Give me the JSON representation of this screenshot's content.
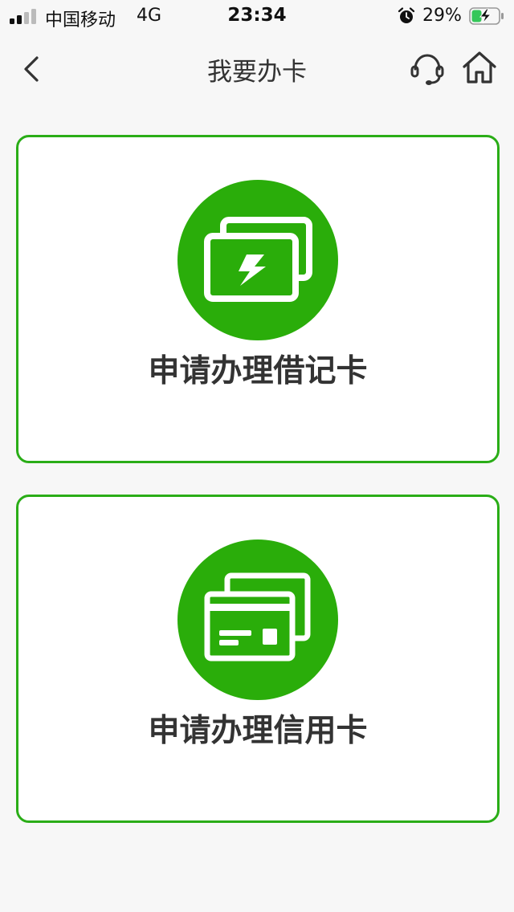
{
  "status_bar": {
    "carrier": "中国移动",
    "network": "4G",
    "time": "23:34",
    "battery_percent": "29%",
    "battery_level": 0.29
  },
  "nav": {
    "title": "我要办卡",
    "back_icon": "chevron-left-icon",
    "support_icon": "headset-icon",
    "home_icon": "home-icon"
  },
  "cards": [
    {
      "label": "申请办理借记卡",
      "icon": "debit-card-lightning-icon"
    },
    {
      "label": "申请办理信用卡",
      "icon": "credit-card-icon"
    }
  ],
  "colors": {
    "accent": "#2aad17",
    "icon_circle": "#2aad0a",
    "background": "#f7f7f7"
  }
}
